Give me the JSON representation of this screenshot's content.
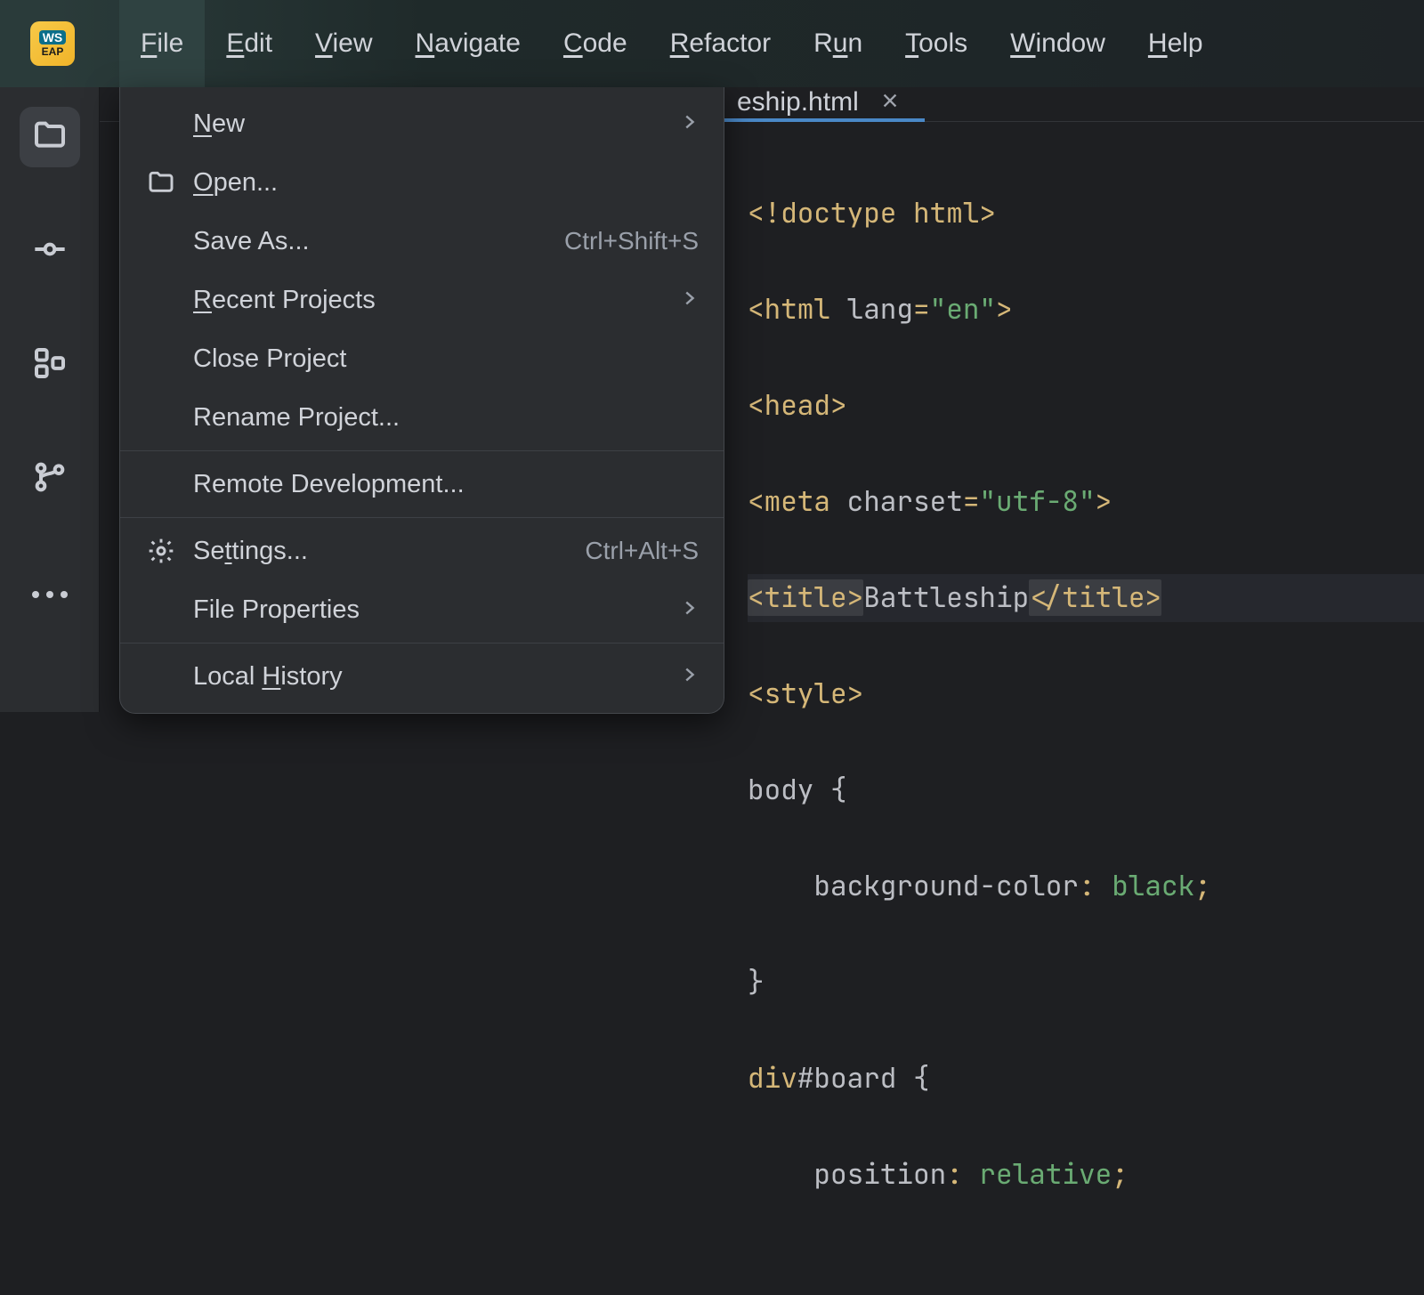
{
  "app_icon": {
    "top": "WS",
    "bottom": "EAP"
  },
  "menu": {
    "items": [
      {
        "label": "File",
        "mnemonic": "F",
        "active": true
      },
      {
        "label": "Edit",
        "mnemonic": "E"
      },
      {
        "label": "View",
        "mnemonic": "V"
      },
      {
        "label": "Navigate",
        "mnemonic": "N"
      },
      {
        "label": "Code",
        "mnemonic": "C"
      },
      {
        "label": "Refactor",
        "mnemonic": "R"
      },
      {
        "label": "Run",
        "mnemonic": "u"
      },
      {
        "label": "Tools",
        "mnemonic": "T"
      },
      {
        "label": "Window",
        "mnemonic": "W"
      },
      {
        "label": "Help",
        "mnemonic": "H"
      }
    ]
  },
  "file_dropdown": {
    "new": {
      "label": "New",
      "mnemonic": "N"
    },
    "open": {
      "label": "Open...",
      "mnemonic": "O"
    },
    "save_as": {
      "label": "Save As...",
      "shortcut": "Ctrl+Shift+S"
    },
    "recent": {
      "label": "Recent Projects",
      "mnemonic": "R"
    },
    "close_project": {
      "label": "Close Project"
    },
    "rename_project": {
      "label": "Rename Project..."
    },
    "remote_dev": {
      "label": "Remote Development..."
    },
    "settings": {
      "label": "Settings...",
      "mnemonic": "t",
      "shortcut": "Ctrl+Alt+S"
    },
    "file_properties": {
      "label": "File Properties"
    },
    "local_history": {
      "label": "Local History",
      "mnemonic": "H"
    }
  },
  "tab": {
    "filename_visible": "eship.html"
  },
  "code": {
    "l1": {
      "a": "<!",
      "b": "doctype ",
      "c": "html",
      "d": ">"
    },
    "l2": {
      "a": "<",
      "b": "html ",
      "c": "lang",
      "d": "=",
      "e": "\"en\"",
      "f": ">"
    },
    "l3": {
      "a": "<",
      "b": "head",
      "c": ">"
    },
    "l4": {
      "a": "<",
      "b": "meta ",
      "c": "charset",
      "d": "=",
      "e": "\"utf-8\"",
      "f": ">"
    },
    "l5": {
      "a": "<",
      "b": "title",
      "c": ">",
      "d": "Battleship",
      "e": "</",
      "f": "title",
      "g": ">"
    },
    "l6": {
      "a": "<",
      "b": "style",
      "c": ">"
    },
    "l7": {
      "a": "body {"
    },
    "l8": {
      "a": "    background-color",
      "b": ": ",
      "c": "black",
      "d": ";"
    },
    "l9": {
      "a": "}"
    },
    "l10": {
      "a": "div",
      "b": "#board ",
      "c": "{"
    },
    "l11": {
      "a": "    position",
      "b": ": ",
      "c": "relative",
      "d": ";"
    }
  }
}
